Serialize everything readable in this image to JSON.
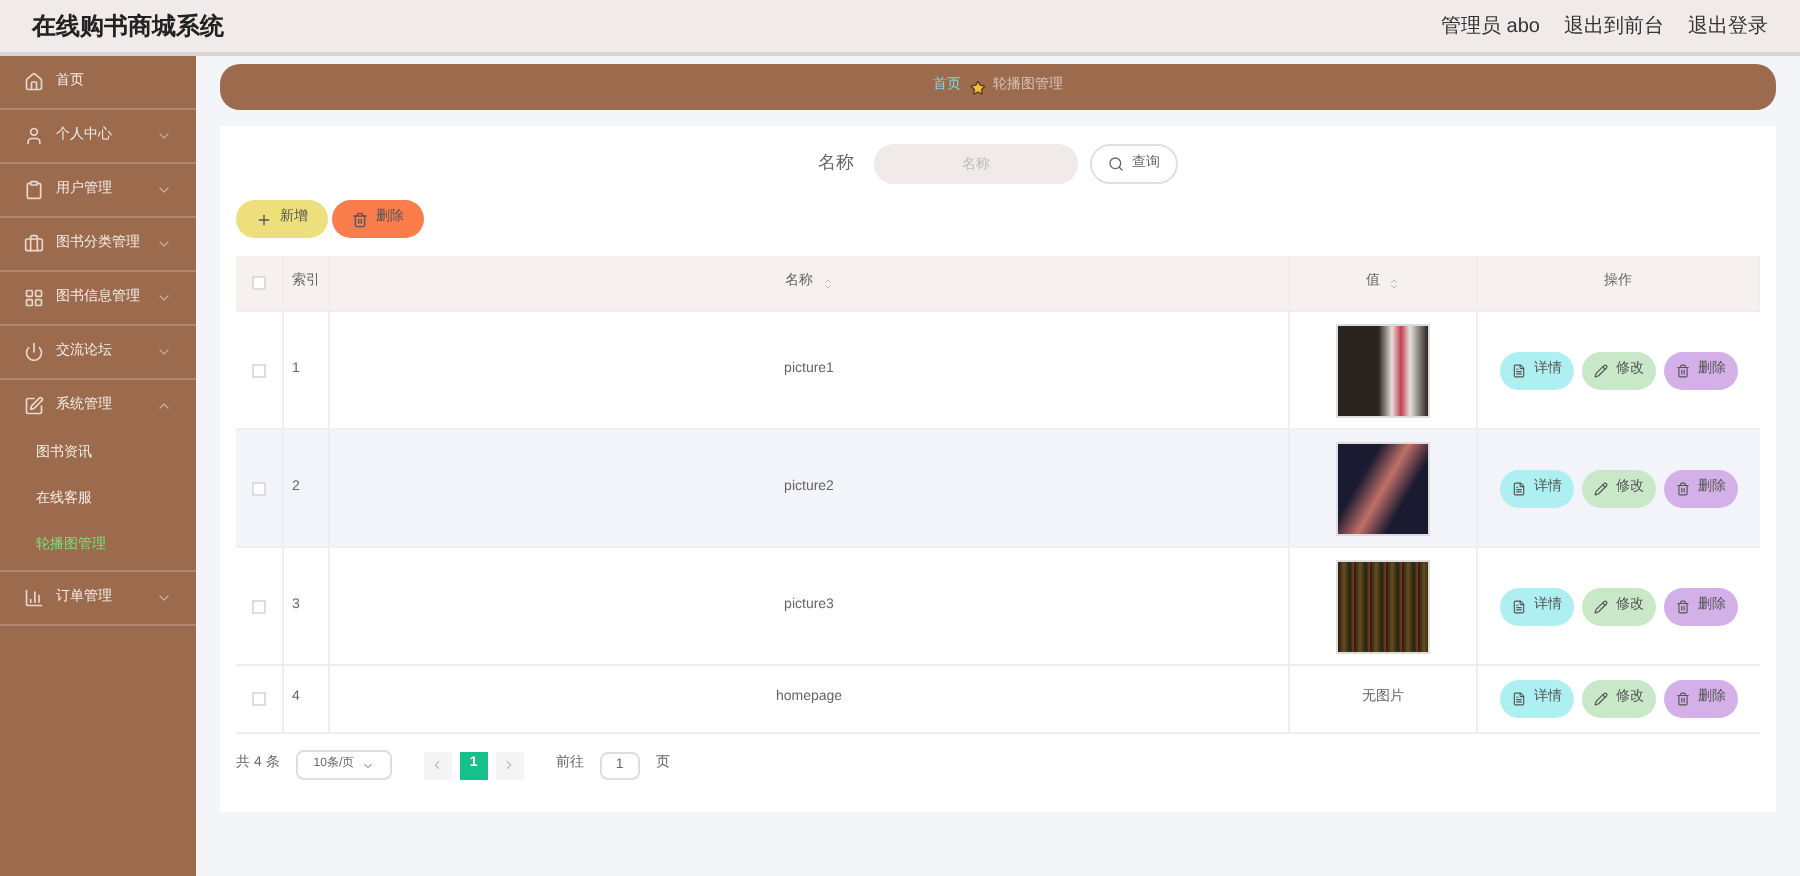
{
  "header": {
    "title": "在线购书商城系统",
    "links": [
      "管理员 abo",
      "退出到前台",
      "退出登录"
    ]
  },
  "sidebar": {
    "items": [
      {
        "kind": "link",
        "label": "首页",
        "selected": false
      },
      {
        "kind": "group",
        "label": "个人中心",
        "expanded": false,
        "selected": false
      },
      {
        "kind": "group",
        "label": "用户管理",
        "expanded": false,
        "selected": false
      },
      {
        "kind": "group",
        "label": "图书分类管理",
        "expanded": false,
        "selected": false
      },
      {
        "kind": "group",
        "label": "图书信息管理",
        "expanded": false,
        "selected": false
      },
      {
        "kind": "group",
        "label": "交流论坛",
        "expanded": false,
        "selected": false
      },
      {
        "kind": "group",
        "label": "系统管理",
        "expanded": true,
        "selected": false,
        "children": [
          {
            "label": "图书资讯",
            "selected": false
          },
          {
            "label": "在线客服",
            "selected": false
          },
          {
            "label": "轮播图管理",
            "selected": true
          }
        ]
      },
      {
        "kind": "group",
        "label": "订单管理",
        "expanded": false,
        "selected": false
      }
    ]
  },
  "breadcrumb": [
    "首页",
    "轮播图管理"
  ],
  "search": {
    "label": "名称",
    "placeholder": "名称",
    "button": "查询"
  },
  "actions": [
    "新增",
    "删除"
  ],
  "table": {
    "select_all_checked": false,
    "columns": [
      {
        "label": "索引",
        "sortable": false
      },
      {
        "label": "名称",
        "sortable": true
      },
      {
        "label": "值",
        "sortable": true
      },
      {
        "label": "操作",
        "sortable": false
      }
    ],
    "rows": [
      {
        "index": "1",
        "name": "picture1",
        "kind": "image",
        "hovered": false,
        "checked": false,
        "buttons": [
          "详情",
          "修改",
          "删除"
        ]
      },
      {
        "index": "2",
        "name": "picture2",
        "kind": "image",
        "hovered": true,
        "checked": false,
        "buttons": [
          "详情",
          "修改",
          "删除"
        ]
      },
      {
        "index": "3",
        "name": "picture3",
        "kind": "image",
        "hovered": false,
        "checked": false,
        "buttons": [
          "详情",
          "修改",
          "删除"
        ]
      },
      {
        "index": "4",
        "name": "homepage",
        "kind": "text",
        "value": "无图片",
        "hovered": false,
        "checked": false,
        "buttons": [
          "详情",
          "修改",
          "删除"
        ]
      }
    ]
  },
  "pagination": {
    "total": "共 4 条",
    "page_size": "10条/页",
    "pages": [
      {
        "label": "1",
        "selected": true
      }
    ],
    "goto_label": "前往",
    "goto_value": "1",
    "goto_suffix": "页"
  }
}
